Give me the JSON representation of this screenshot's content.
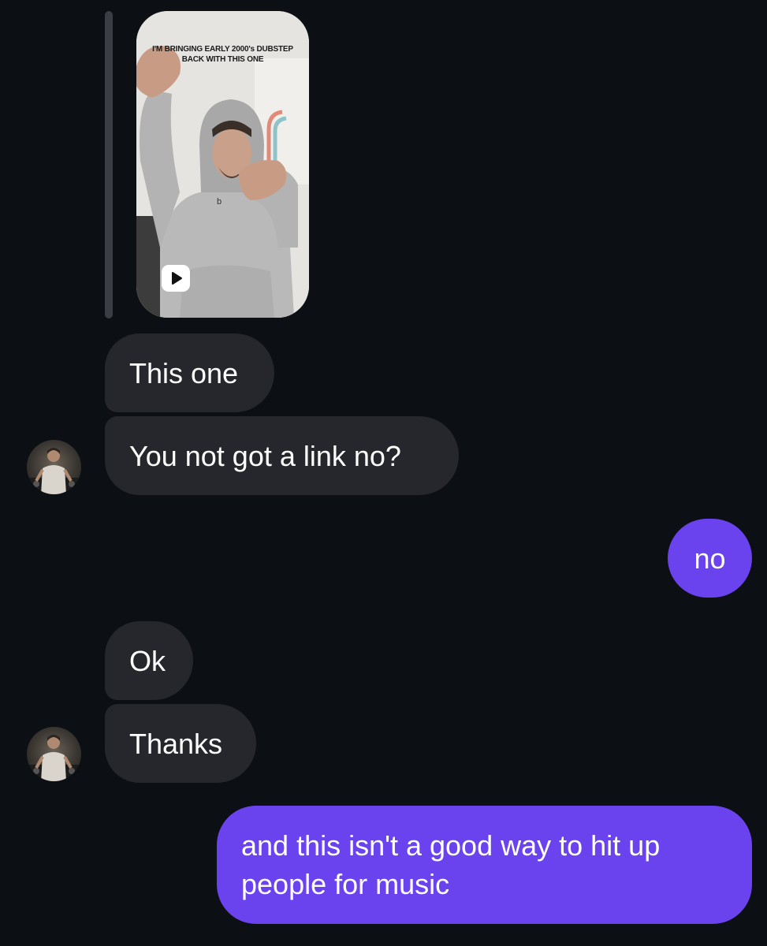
{
  "reply_preview": {
    "reel_caption": "I'M BRINGING EARLY 2000's DUBSTEP\nBACK WITH THIS ONE",
    "reel_icon": "play-icon",
    "hoodie_logo": "b"
  },
  "messages": [
    {
      "sender": "them",
      "text": "This one"
    },
    {
      "sender": "them",
      "text": "You not got a link no?"
    },
    {
      "sender": "me",
      "text": "no"
    },
    {
      "sender": "them",
      "text": "Ok"
    },
    {
      "sender": "them",
      "text": "Thanks"
    },
    {
      "sender": "me",
      "text": "and this isn't a good way to hit up\npeople for music"
    }
  ],
  "colors": {
    "background": "#0c0f14",
    "incoming_bubble": "#25272c",
    "outgoing_bubble": "#6a43ef"
  }
}
